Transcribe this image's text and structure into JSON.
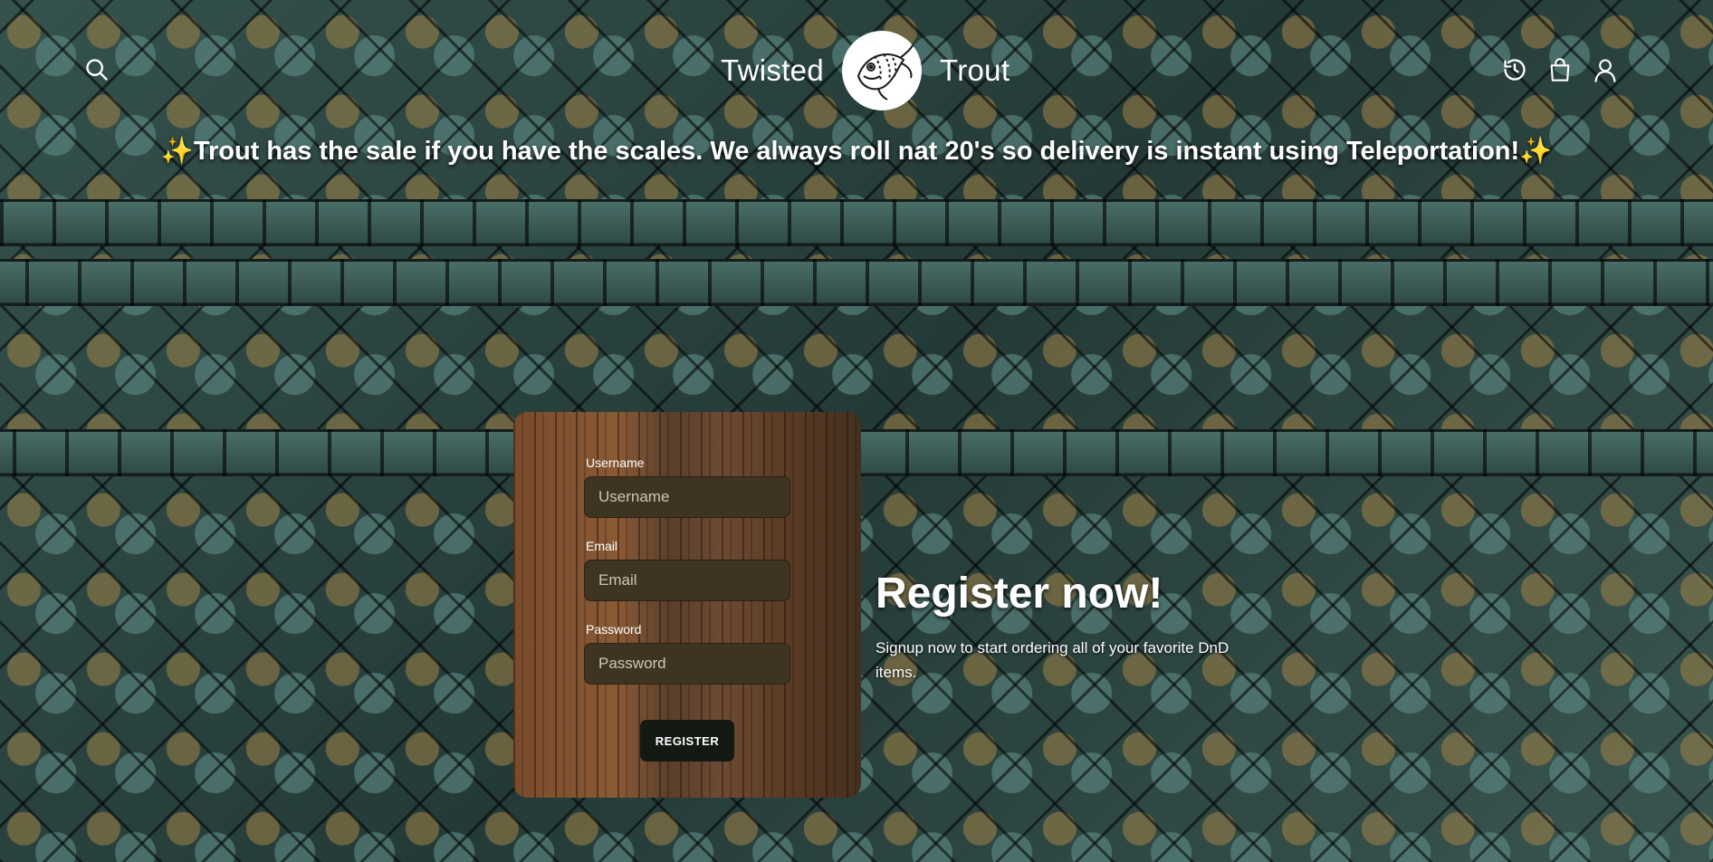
{
  "header": {
    "brand_left": "Twisted",
    "brand_right": "Trout",
    "icons": [
      "search-icon",
      "history-icon",
      "shopping-bag-icon",
      "user-icon"
    ]
  },
  "announcement": {
    "text": "Trout has the sale if you have the scales. We always roll nat 20's so delivery is instant using Teleportation!",
    "emoji_left": "✨",
    "emoji_right": "✨"
  },
  "form": {
    "username_label": "Username",
    "username_placeholder": "Username",
    "username_value": "",
    "email_label": "Email",
    "email_placeholder": "Email",
    "email_value": "",
    "password_label": "Password",
    "password_placeholder": "Password",
    "password_value": "",
    "submit_label": "REGISTER"
  },
  "promo": {
    "heading": "Register now!",
    "body": "Signup now to start ordering all of your favorite DnD items."
  },
  "colors": {
    "background": "#2c4642",
    "input_bg": "#3f3422",
    "button_bg": "#151914",
    "text": "#ffffff"
  }
}
